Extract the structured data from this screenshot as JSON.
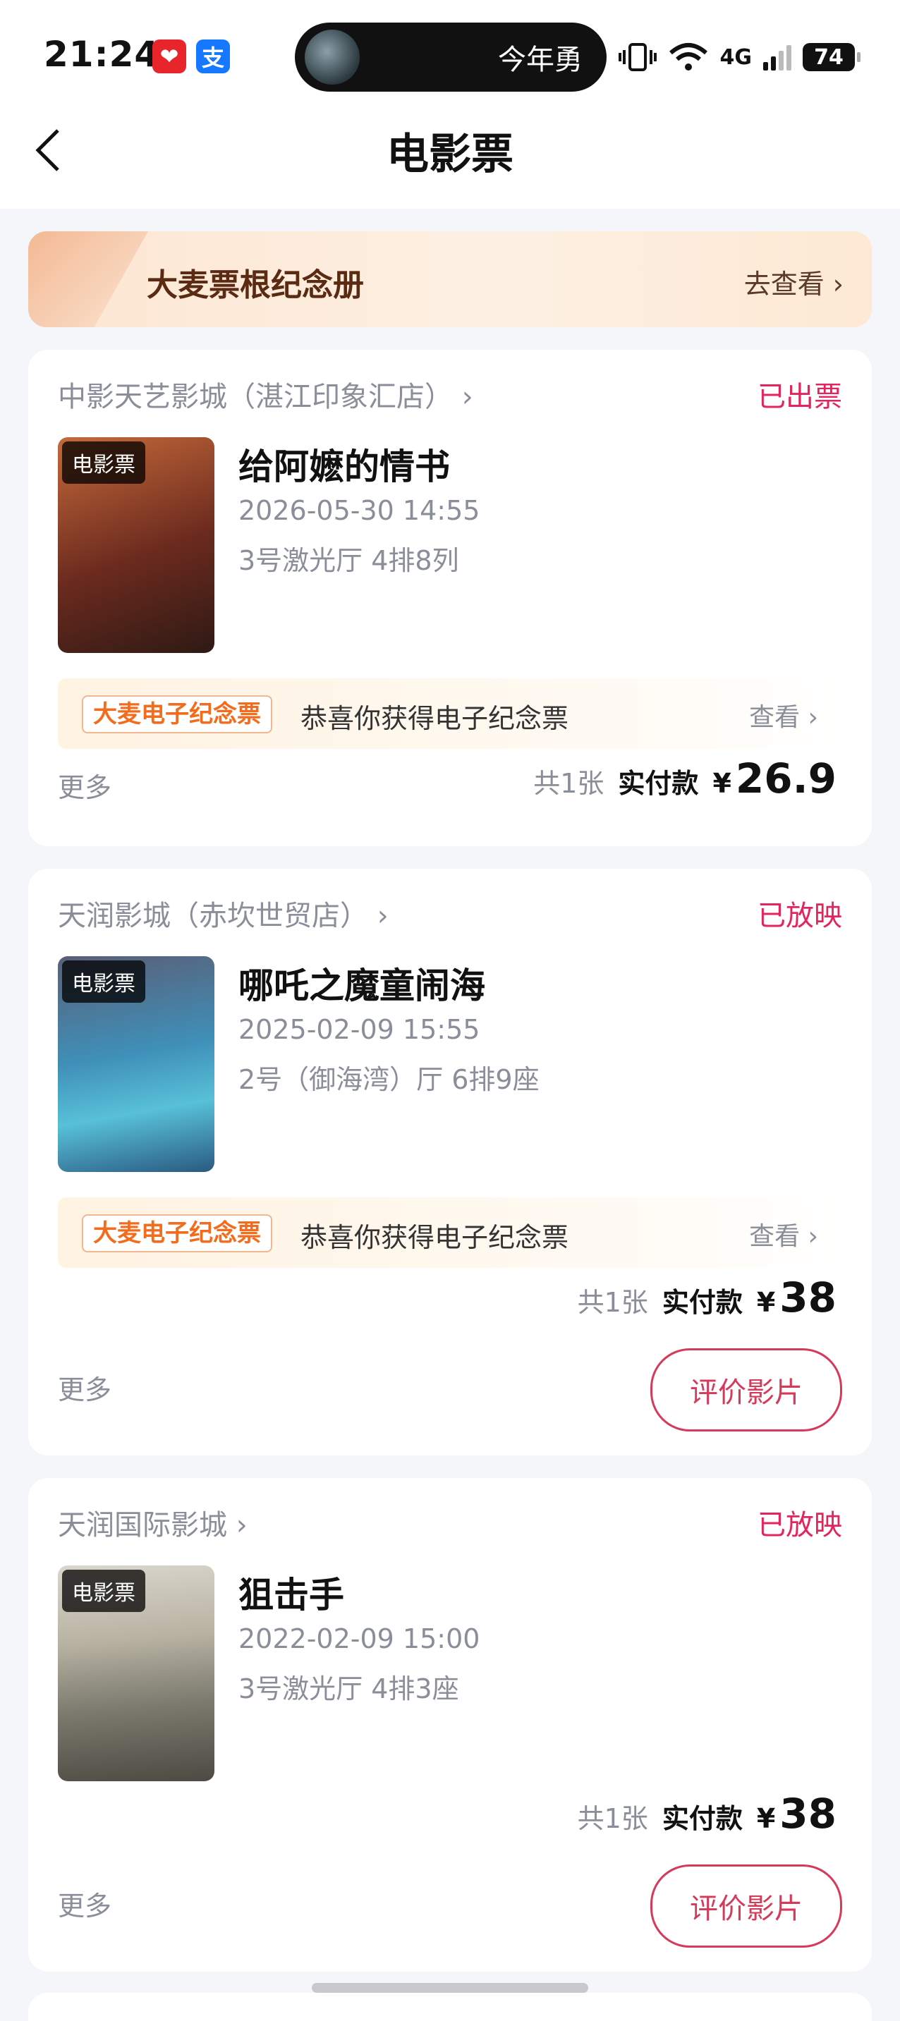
{
  "status_bar": {
    "time": "21:24",
    "app_icon_1": "❤",
    "app_icon_2": "支",
    "island_text": "今年勇",
    "network": "4G",
    "battery": "74"
  },
  "header": {
    "title": "电影票"
  },
  "banner": {
    "title": "大麦票根纪念册",
    "link": "去查看 ›"
  },
  "orders": [
    {
      "cinema": "中影天艺影城（湛江印象汇店） ›",
      "status": "已出票",
      "poster_tag": "电影票",
      "title": "给阿嬷的情书",
      "time": "2026-05-30 14:55",
      "hall": "3号激光厅 4排8列",
      "souvenir_badge": "大麦电子纪念票",
      "souvenir_text": "恭喜你获得电子纪念票",
      "souvenir_view": "查看 ›",
      "more": "更多",
      "count": "共1张",
      "paid_label": "实付款",
      "currency": "¥",
      "amount": "26.9",
      "poster_color": "#6b2a1e"
    },
    {
      "cinema": "天润影城（赤坎世贸店） ›",
      "status": "已放映",
      "poster_tag": "电影票",
      "title": "哪吒之魔童闹海",
      "time": "2025-02-09 15:55",
      "hall": "2号（御海湾）厅 6排9座",
      "souvenir_badge": "大麦电子纪念票",
      "souvenir_text": "恭喜你获得电子纪念票",
      "souvenir_view": "查看 ›",
      "more": "更多",
      "count": "共1张",
      "paid_label": "实付款",
      "currency": "¥",
      "amount": "38",
      "rate_button": "评价影片",
      "poster_color": "#3f8fb8"
    },
    {
      "cinema": "天润国际影城 ›",
      "status": "已放映",
      "poster_tag": "电影票",
      "title": "狙击手",
      "time": "2022-02-09 15:00",
      "hall": "3号激光厅 4排3座",
      "more": "更多",
      "count": "共1张",
      "paid_label": "实付款",
      "currency": "¥",
      "amount": "38",
      "rate_button": "评价影片",
      "poster_color": "#7a7a6e"
    }
  ]
}
